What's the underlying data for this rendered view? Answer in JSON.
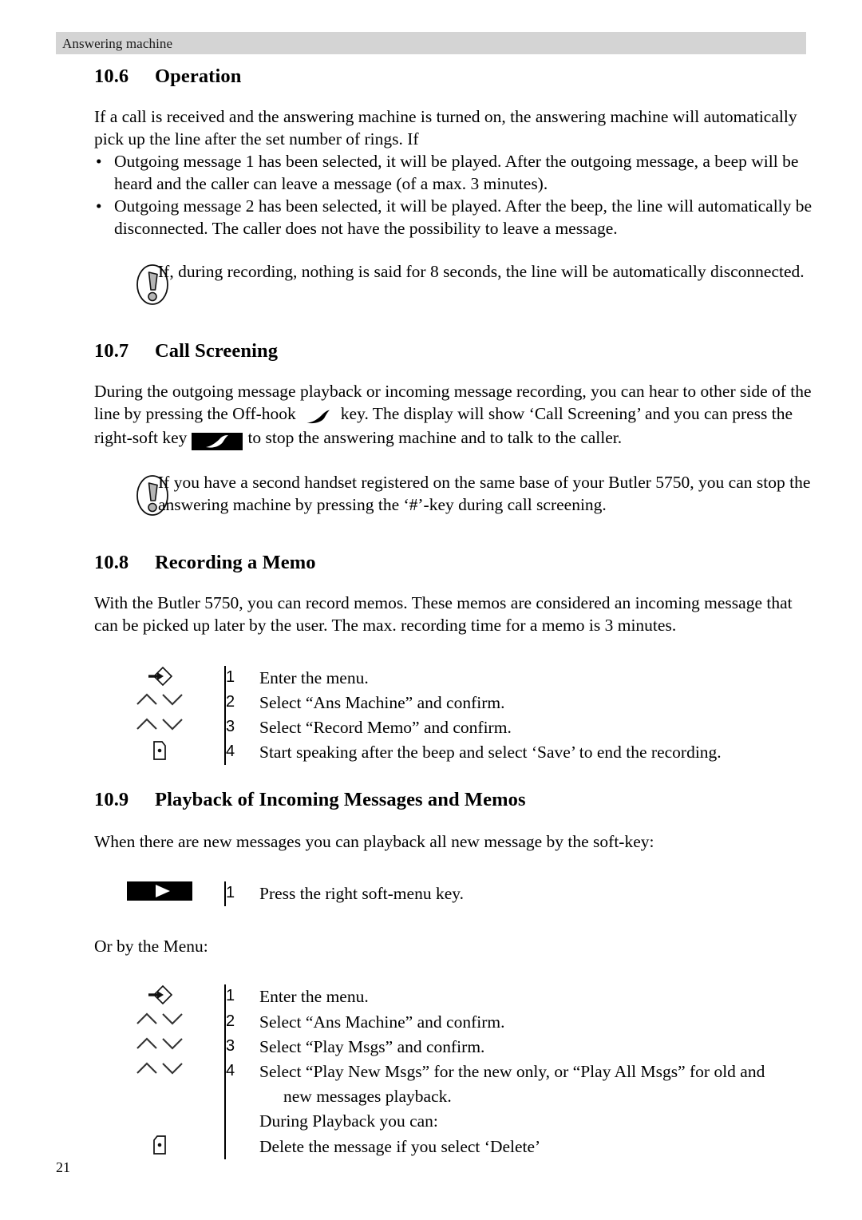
{
  "header": {
    "running_title": "Answering machine"
  },
  "page_number": "21",
  "sections": {
    "operation": {
      "number": "10.6",
      "title": "Operation",
      "intro": "If a call is received and the answering machine is turned on, the answering machine will automatically pick up the line after the set number of rings. If",
      "bullet_char": "•",
      "bullets": [
        "Outgoing message 1 has been selected, it will be played. After the outgoing message, a beep will be heard and the caller can leave a message (of a max. 3 minutes).",
        "Outgoing message 2 has been selected, it will be played. After the beep, the line will automatically be disconnected. The caller does not have the possibility to leave a message."
      ],
      "note": {
        "icon": "exclamation-in-circle-icon",
        "text": "If, during recording, nothing is said for 8 seconds, the line will be automatically disconnected."
      }
    },
    "call_screening": {
      "number": "10.7",
      "title": "Call Screening",
      "para_part1": "During the outgoing message playback or incoming message recording, you can hear to other side of the line by pressing the Off-hook",
      "offhook_icon": "phone-handset-icon",
      "para_part2": "key.  The display will show ‘Call Screening’ and you can press the right-soft key",
      "softkey_icon": "softkey-handset-icon",
      "para_part3": "to stop the answering machine and to talk to the caller.",
      "note": {
        "icon": "exclamation-in-circle-icon",
        "text": "If you have a second handset registered on the same base of your Butler 5750, you can stop the answering machine by pressing the ‘#’-key during call screening."
      }
    },
    "recording_memo": {
      "number": "10.8",
      "title": "Recording a Memo",
      "intro": "With the Butler 5750, you can record memos. These memos are considered an incoming message that can be picked up later by the user. The max. recording time for a memo is 3 minutes.",
      "steps": [
        {
          "icon": "menu-key-icon",
          "num": "1",
          "text": "Enter the menu."
        },
        {
          "icon": "up-down-arrows-icon",
          "num": "2",
          "text": "Select “Ans Machine” and confirm."
        },
        {
          "icon": "up-down-arrows-icon",
          "num": "3",
          "text": "Select “Record Memo” and confirm."
        },
        {
          "icon": "right-softkey-icon",
          "num": "4",
          "text": "Start speaking after the beep and select ‘Save’ to end the recording."
        }
      ]
    },
    "playback": {
      "number": "10.9",
      "title": "Playback of Incoming Messages and Memos",
      "intro": "When there are new messages you can playback all new message by the soft-key:",
      "softkey_steps": [
        {
          "icon": "play-softkey-icon",
          "num": "1",
          "text": "Press the right soft-menu key."
        }
      ],
      "or_menu_label": "Or by the Menu:",
      "menu_steps": [
        {
          "icon": "menu-key-icon",
          "num": "1",
          "text": "Enter the menu."
        },
        {
          "icon": "up-down-arrows-icon",
          "num": "2",
          "text": "Select “Ans Machine” and confirm."
        },
        {
          "icon": "up-down-arrows-icon",
          "num": "3",
          "text": "Select “Play Msgs” and confirm."
        },
        {
          "icon": "up-down-arrows-icon",
          "num": "4",
          "text": "Select “Play New Msgs”  for the new only, or “Play All Msgs” for old and"
        }
      ],
      "step4_continued": "new messages playback.",
      "during_playback_label": "During Playback you can:",
      "delete_row": {
        "icon": "left-softkey-icon",
        "text": "Delete the message if you select ‘Delete’"
      }
    }
  },
  "colors": {
    "header_bar": "#d4d4d4",
    "text": "#000000",
    "icon_fill": "#000000",
    "note_icon_gray": "#b5b5b5"
  }
}
